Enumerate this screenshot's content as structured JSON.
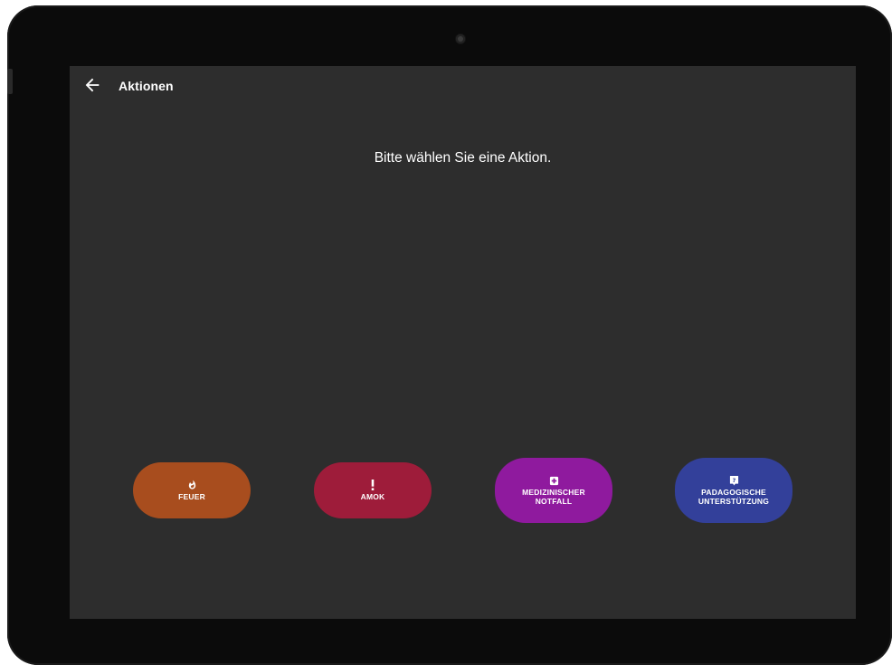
{
  "app": {
    "title": "Aktionen",
    "prompt": "Bitte wählen Sie eine Aktion."
  },
  "icons": {
    "back": "arrow-left-icon",
    "feuer": "fire-icon",
    "amok": "exclamation-icon",
    "medizinisch": "medical-cross-icon",
    "paedagogisch": "question-icon"
  },
  "actions": [
    {
      "label": "FEUER",
      "color": "#a84d1e"
    },
    {
      "label": "AMOK",
      "color": "#9e1c3a"
    },
    {
      "label_line1": "MEDIZINISCHER",
      "label_line2": "NOTFALL",
      "color": "#8f1a9e"
    },
    {
      "label_line1": "PADAGOGISCHE",
      "label_line2": "UNTERSTÜTZUNG",
      "color": "#33409a"
    }
  ],
  "colors": {
    "screen_background": "#2d2d2d",
    "text": "#ffffff"
  }
}
